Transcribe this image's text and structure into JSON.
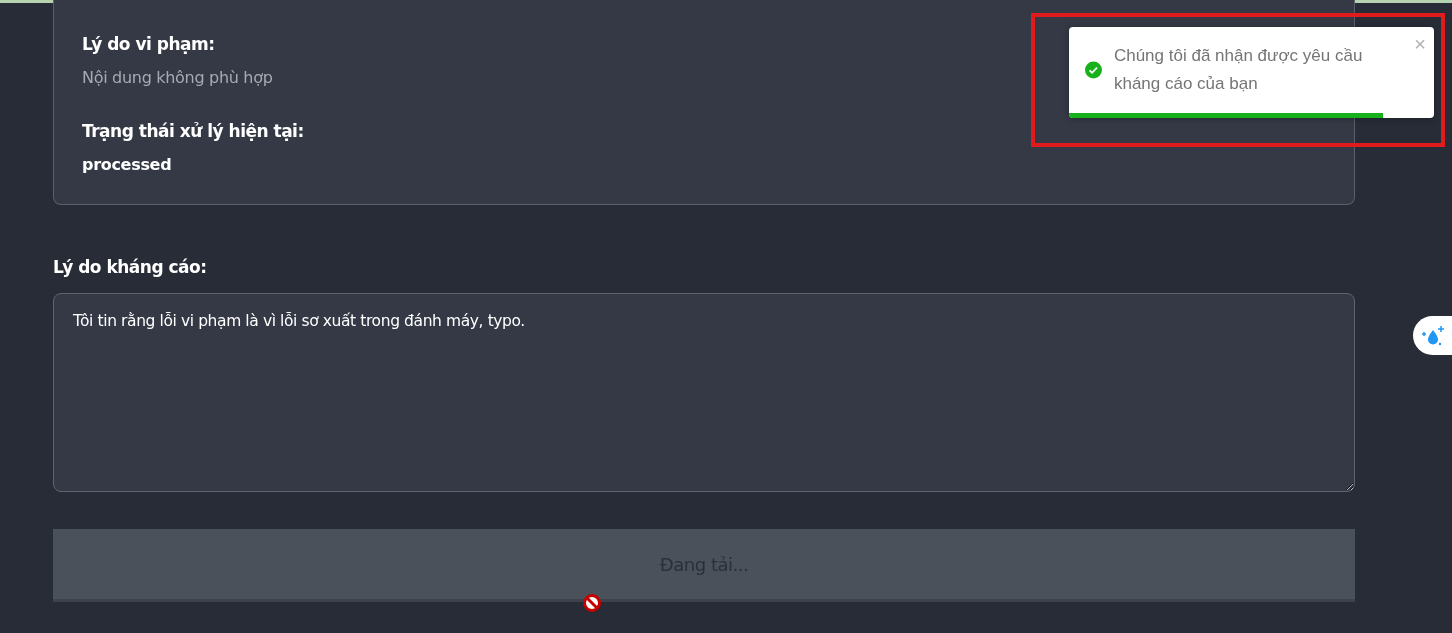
{
  "violation_card": {
    "fields": [
      {
        "label": "Lý do vi phạm:",
        "value": "Nội dung không phù hợp",
        "kind": "muted"
      },
      {
        "label": "Trạng thái xử lý hiện tại:",
        "value": "processed",
        "kind": "bold"
      }
    ]
  },
  "appeal": {
    "label": "Lý do kháng cáo:",
    "value": "Tôi tin rằng lỗi vi phạm là vì lỗi sơ xuất trong đánh máy, typo."
  },
  "submit_button": {
    "label": "Đang tải...",
    "disabled": true
  },
  "toast": {
    "message": "Chúng tôi đã nhận được yêu cầu kháng cáo của bạn",
    "close": "×",
    "level": 0.86,
    "highlighted": true
  }
}
